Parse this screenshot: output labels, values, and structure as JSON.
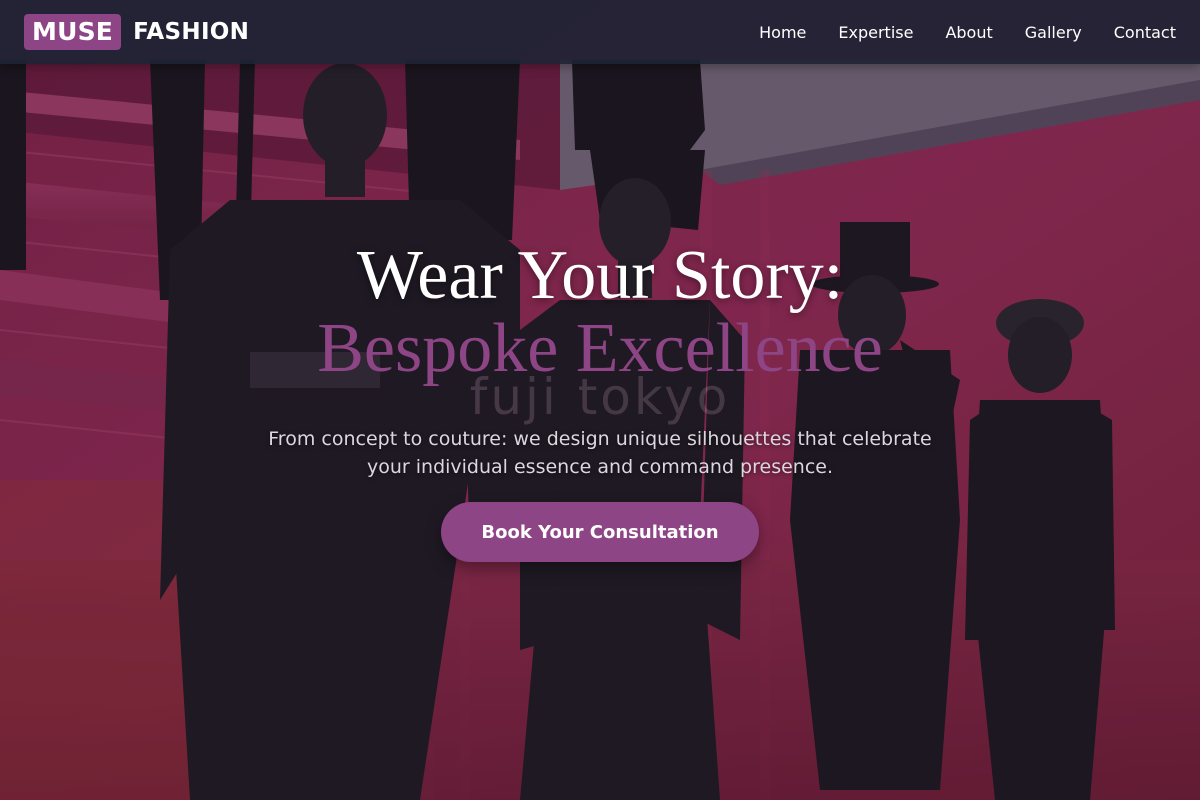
{
  "header": {
    "brand_box": "MUSE",
    "brand_word": "FASHION",
    "nav": [
      "Home",
      "Expertise",
      "About",
      "Gallery",
      "Contact"
    ]
  },
  "hero": {
    "title_line1": "Wear Your Story:",
    "title_line2": "Bespoke Excellence",
    "watermark": "fuji tokyo",
    "subtitle": "From concept to couture: we design unique silhouettes that celebrate your individual essence and command presence.",
    "cta_label": "Book Your Consultation"
  },
  "colors": {
    "accent": "#8e4585",
    "header_bg": "#1e2434",
    "backdrop": "#b8326a",
    "garment": "#1c1a22"
  },
  "icons": []
}
